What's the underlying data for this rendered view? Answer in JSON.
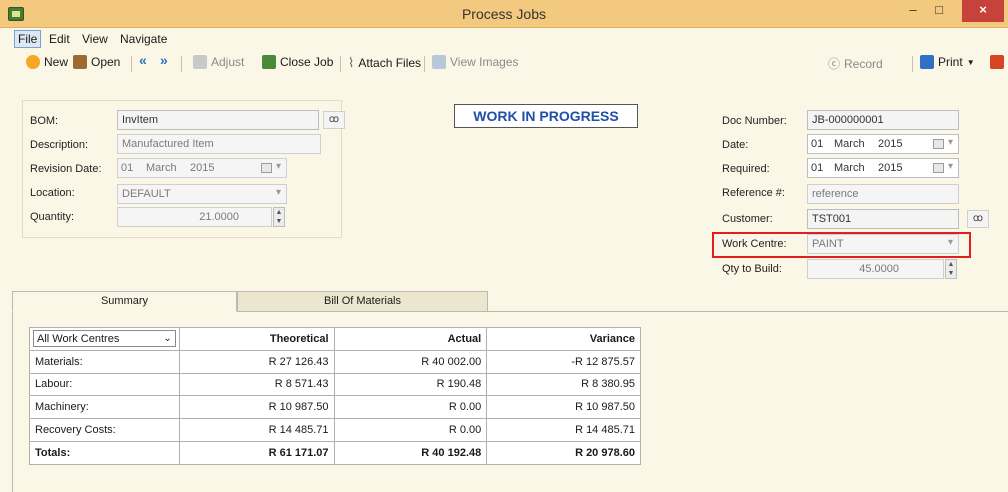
{
  "window": {
    "title": "Process Jobs",
    "minimize": "–",
    "maximize": "□",
    "close": "×"
  },
  "menu": {
    "file": "File",
    "edit": "Edit",
    "view": "View",
    "navigate": "Navigate"
  },
  "toolbar": {
    "new": "New",
    "open": "Open",
    "adjust": "Adjust",
    "close_job": "Close Job",
    "attach_files": "Attach Files",
    "view_images": "View Images",
    "record": "Record",
    "print": "Print"
  },
  "form": {
    "bom_label": "BOM:",
    "bom_value": "InvItem",
    "description_label": "Description:",
    "description_value": "Manufactured Item",
    "revision_date_label": "Revision Date:",
    "revision_day": "01",
    "revision_month": "March",
    "revision_year": "2015",
    "location_label": "Location:",
    "location_value": "DEFAULT",
    "quantity_label": "Quantity:",
    "quantity_value": "21.0000"
  },
  "status_banner": "WORK IN PROGRESS",
  "doc": {
    "doc_number_label": "Doc Number:",
    "doc_number_value": "JB-000000001",
    "date_label": "Date:",
    "date_day": "01",
    "date_month": "March",
    "date_year": "2015",
    "required_label": "Required:",
    "required_day": "01",
    "required_month": "March",
    "required_year": "2015",
    "reference_label": "Reference #:",
    "reference_value": "reference",
    "customer_label": "Customer:",
    "customer_value": "TST001",
    "work_centre_label": "Work Centre:",
    "work_centre_value": "PAINT",
    "qty_to_build_label": "Qty to Build:",
    "qty_to_build_value": "45.0000"
  },
  "tabs": {
    "summary": "Summary",
    "bill_of_materials": "Bill Of Materials"
  },
  "summary": {
    "filter": "All Work Centres",
    "headers": {
      "theoretical": "Theoretical",
      "actual": "Actual",
      "variance": "Variance"
    },
    "rows": [
      {
        "label": "Materials:",
        "theoretical": "R 27 126.43",
        "actual": "R 40 002.00",
        "variance": "-R 12 875.57"
      },
      {
        "label": "Labour:",
        "theoretical": "R 8 571.43",
        "actual": "R 190.48",
        "variance": "R 8 380.95"
      },
      {
        "label": "Machinery:",
        "theoretical": "R 10 987.50",
        "actual": "R 0.00",
        "variance": "R 10 987.50"
      },
      {
        "label": "Recovery Costs:",
        "theoretical": "R 14 485.71",
        "actual": "R 0.00",
        "variance": "R 14 485.71"
      },
      {
        "label": "Totals:",
        "theoretical": "R 61 171.07",
        "actual": "R 40 192.48",
        "variance": "R 20 978.60"
      }
    ]
  }
}
